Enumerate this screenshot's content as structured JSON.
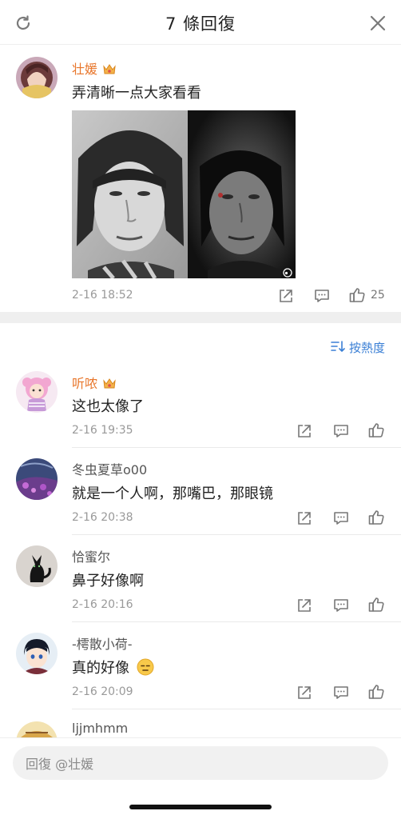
{
  "header": {
    "title": "7 條回復"
  },
  "main": {
    "username": "壮媛",
    "text": "弄清晰一点大家看看",
    "time": "2-16 18:52",
    "like_count": "25"
  },
  "sort": {
    "label": "按熱度"
  },
  "replies": [
    {
      "username": "听哝",
      "text": "这也太像了",
      "time": "2-16 19:35"
    },
    {
      "username": "冬虫夏草o00",
      "text": "就是一个人啊，那嘴巴，那眼镜",
      "time": "2-16 20:38"
    },
    {
      "username": "恰蜜尔",
      "text": "鼻子好像啊",
      "time": "2-16 20:16"
    },
    {
      "username": "-樗散小荷-",
      "text": "真的好像",
      "time": "2-16 20:09"
    },
    {
      "username": "ljjmhmm"
    }
  ],
  "input": {
    "placeholder": "回復 @壮媛"
  },
  "colors": {
    "accent_orange": "#e8762b",
    "link_blue": "#3a7fd5",
    "muted": "#999999"
  },
  "icons": [
    "refresh-icon",
    "close-icon",
    "crown-icon",
    "share-icon",
    "comment-icon",
    "like-icon",
    "sort-icon",
    "emoji-icon"
  ]
}
